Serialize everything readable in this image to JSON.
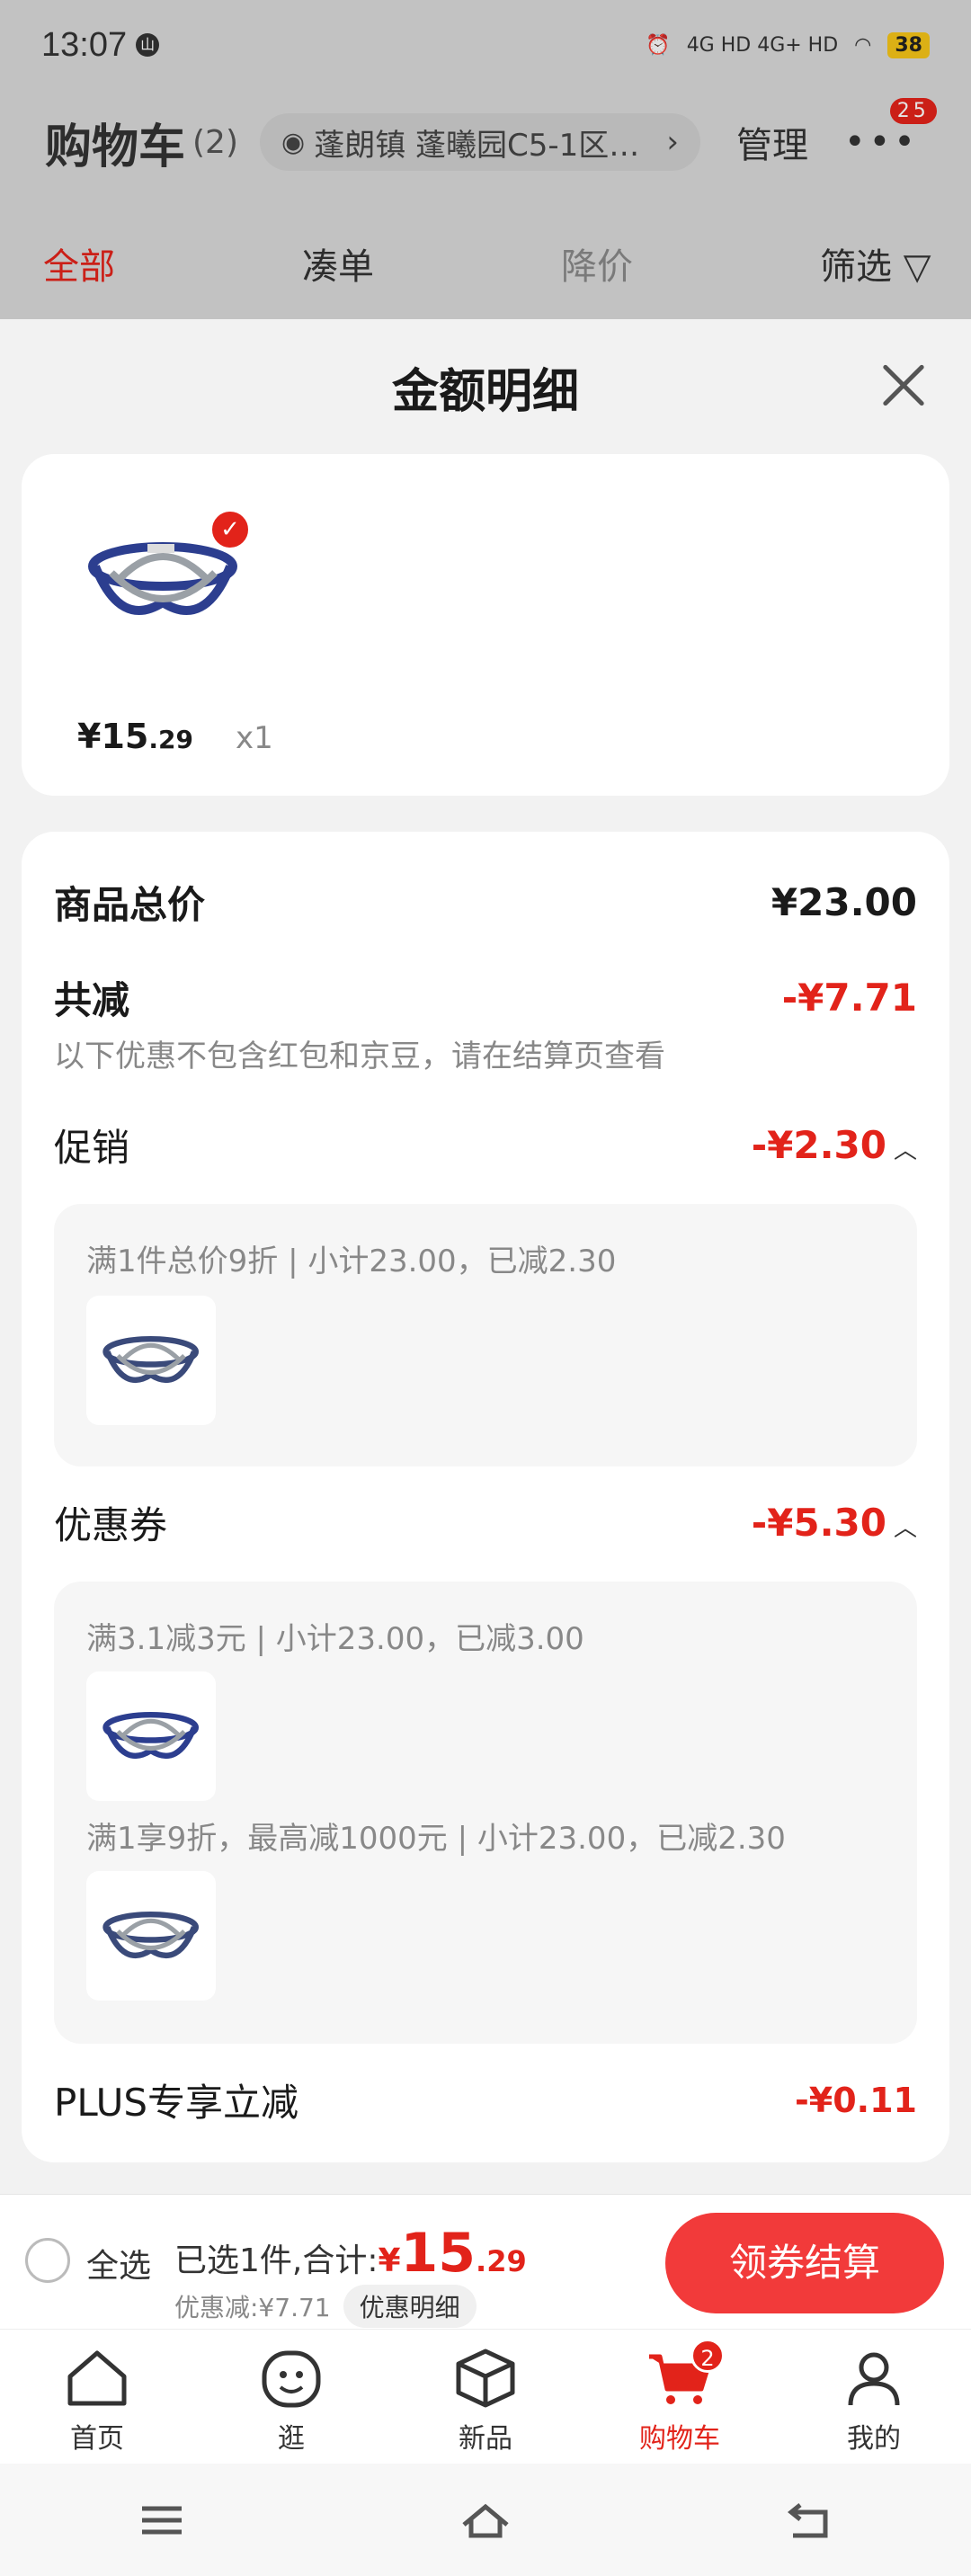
{
  "status_bar": {
    "time": "13:07",
    "time_badge": "山",
    "network": "4G HD  4G+ HD",
    "battery": "38"
  },
  "background_page": {
    "title": "购物车",
    "count": "(2)",
    "address": "蓬朗镇 蓬曦园C5-1区…",
    "manage_label": "管理",
    "more_badge": "25",
    "tabs": [
      {
        "label": "全部"
      },
      {
        "label": "凑单"
      },
      {
        "label": "降价"
      },
      {
        "label": "筛选"
      }
    ]
  },
  "sheet": {
    "title": "金额明细",
    "product": {
      "price_symbol": "¥",
      "price_int": "15",
      "price_dec": ".29",
      "quantity": "x1"
    },
    "detail": {
      "total_label": "商品总价",
      "total_value": "¥23.00",
      "reduce_label": "共减",
      "reduce_value": "-¥7.71",
      "reduce_note": "以下优惠不包含红包和京豆，请在结算页查看",
      "promo_label": "促销",
      "promo_value": "-¥2.30",
      "promo_rule": "满1件总价9折 | 小计23.00，已减2.30",
      "coupon_label": "优惠券",
      "coupon_value": "-¥5.30",
      "coupon_rule_1": "满3.1减3元 | 小计23.00，已减3.00",
      "coupon_rule_2": "满1享9折，最高减1000元 | 小计23.00，已减2.30",
      "plus_label": "PLUS专享立减",
      "plus_value": "-¥0.11"
    }
  },
  "checkout": {
    "select_all": "全选",
    "summary_prefix": "已选1件,合计:",
    "currency": "¥",
    "amount_int": "15",
    "amount_dec": ".29",
    "discount_text": "优惠减:¥7.71",
    "detail_chip": "优惠明细",
    "pay_button": "领券结算"
  },
  "tabbar": {
    "items": [
      {
        "label": "首页",
        "icon": "home-icon"
      },
      {
        "label": "逛",
        "icon": "smile-face-icon"
      },
      {
        "label": "新品",
        "icon": "box-icon"
      },
      {
        "label": "购物车",
        "icon": "cart-icon",
        "badge": "2"
      },
      {
        "label": "我的",
        "icon": "user-icon"
      }
    ]
  },
  "colors": {
    "accent": "#e2231a",
    "pay_button": "#f23a3a"
  }
}
